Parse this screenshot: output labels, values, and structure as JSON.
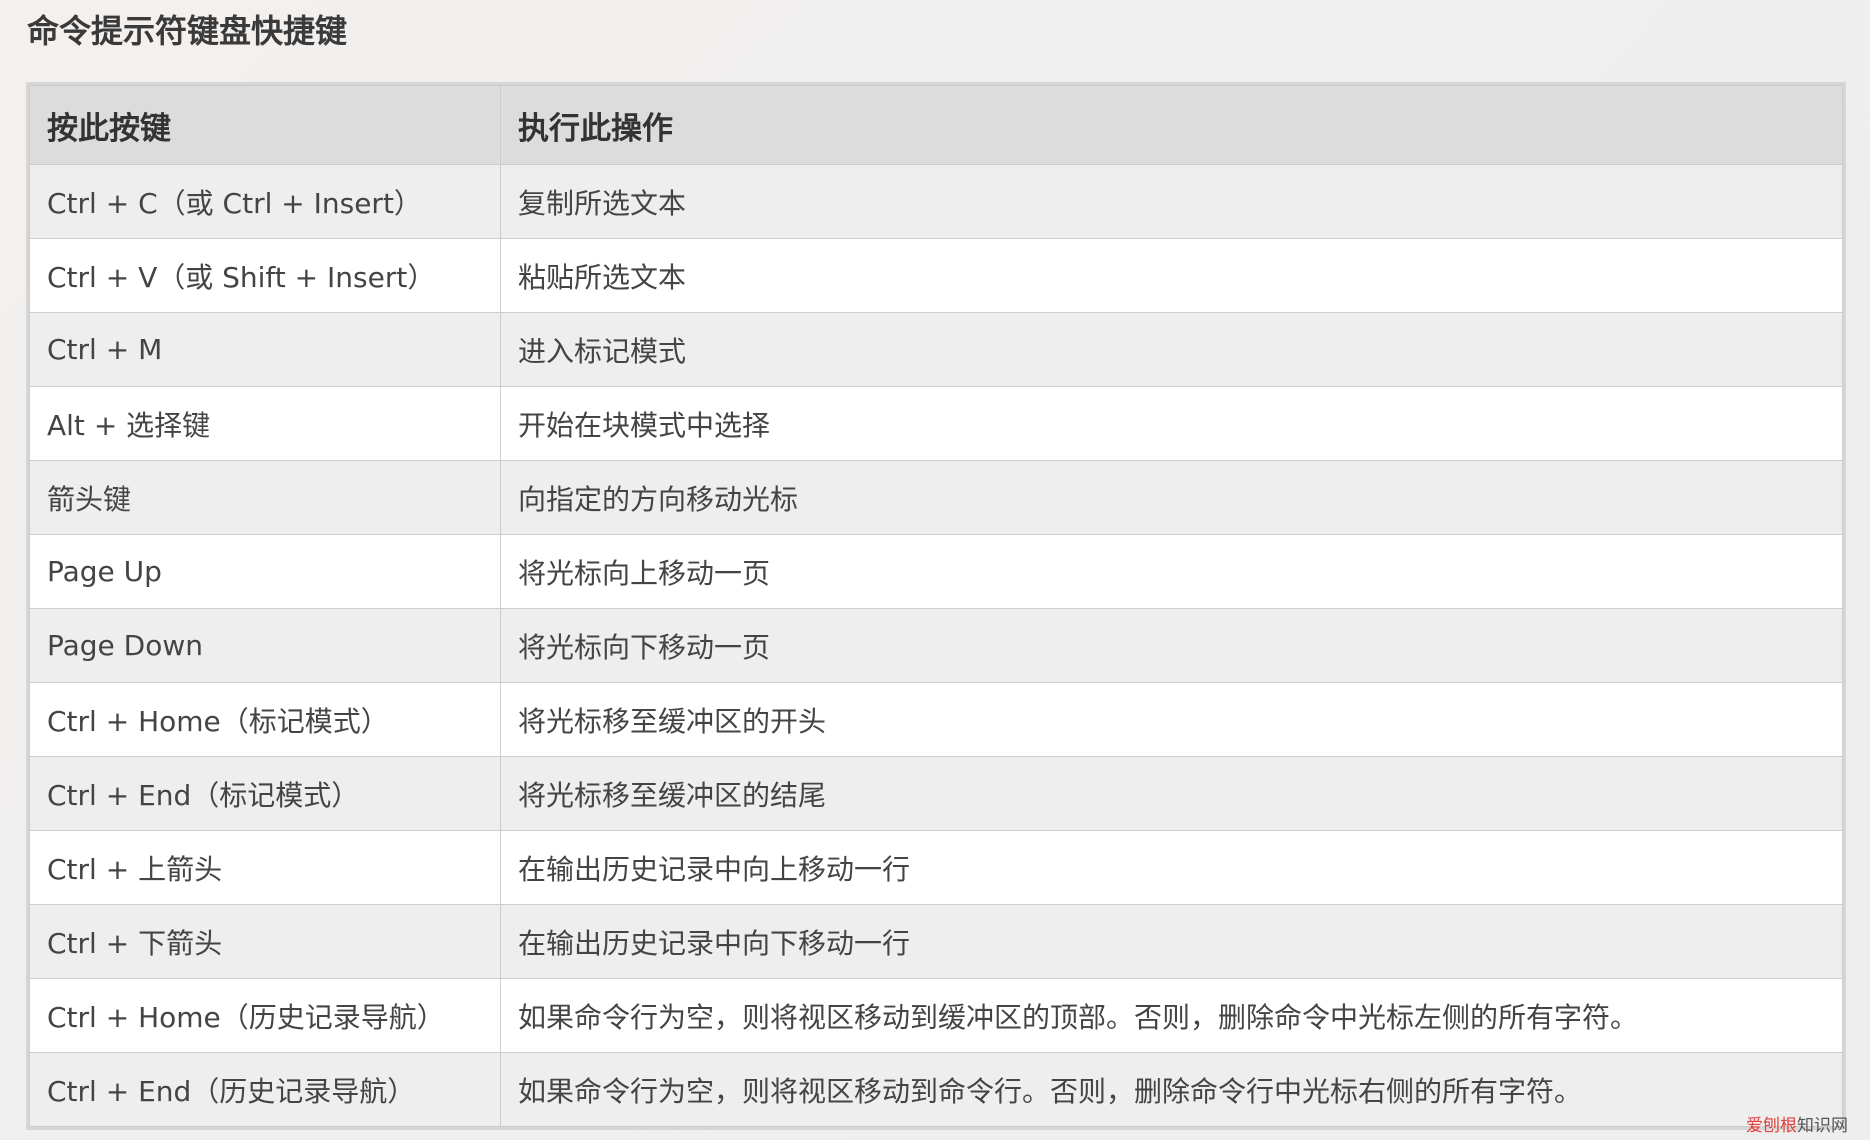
{
  "page": {
    "title": "命令提示符键盘快捷键"
  },
  "table": {
    "headers": [
      "按此按键",
      "执行此操作"
    ],
    "rows": [
      [
        "Ctrl + C（或 Ctrl + Insert）",
        "复制所选文本"
      ],
      [
        "Ctrl + V（或 Shift + Insert）",
        "粘贴所选文本"
      ],
      [
        "Ctrl + M",
        "进入标记模式"
      ],
      [
        "Alt + 选择键",
        "开始在块模式中选择"
      ],
      [
        "箭头键",
        "向指定的方向移动光标"
      ],
      [
        "Page Up",
        "将光标向上移动一页"
      ],
      [
        "Page Down",
        "将光标向下移动一页"
      ],
      [
        "Ctrl + Home（标记模式）",
        "将光标移至缓冲区的开头"
      ],
      [
        "Ctrl + End（标记模式）",
        "将光标移至缓冲区的结尾"
      ],
      [
        "Ctrl + 上箭头",
        "在输出历史记录中向上移动一行"
      ],
      [
        "Ctrl + 下箭头",
        "在输出历史记录中向下移动一行"
      ],
      [
        "Ctrl + Home（历史记录导航）",
        "如果命令行为空，则将视区移动到缓冲区的顶部。否则，删除命令中光标左侧的所有字符。"
      ],
      [
        "Ctrl + End（历史记录导航）",
        "如果命令行为空，则将视区移动到命令行。否则，删除命令行中光标右侧的所有字符。"
      ]
    ]
  },
  "watermark": {
    "brand": "爱刨根",
    "suffix": "知识网"
  },
  "colors": {
    "header_bg": "#dcdcdc",
    "row_odd_bg": "#eeeeee",
    "row_even_bg": "#ffffff",
    "border": "#cccccc",
    "watermark_brand": "#e0413d"
  }
}
